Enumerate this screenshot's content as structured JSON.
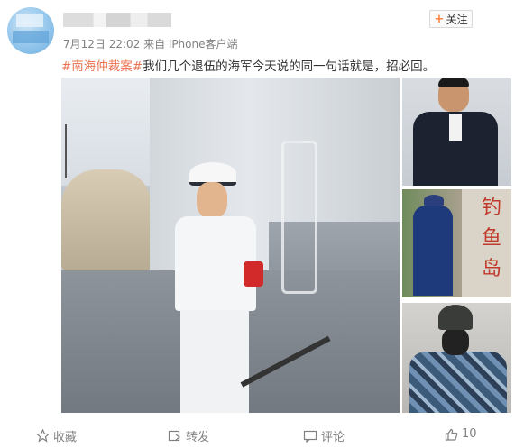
{
  "post": {
    "time": "7月12日 22:02",
    "source_prefix": "来自",
    "source": "iPhone客户端",
    "follow_label": "关注",
    "hashtag": "#南海仲裁案#",
    "text": "我们几个退伍的海军今天说的同一句话就是，招必回。"
  },
  "photos": {
    "rock_inscription": "钓鱼岛"
  },
  "footer": {
    "favorite_label": "收藏",
    "repost_label": "转发",
    "comment_label": "评论",
    "like_count": "10"
  },
  "colors": {
    "hashtag": "#eb7350",
    "accent": "#ff8140",
    "meta_text": "#808080"
  }
}
